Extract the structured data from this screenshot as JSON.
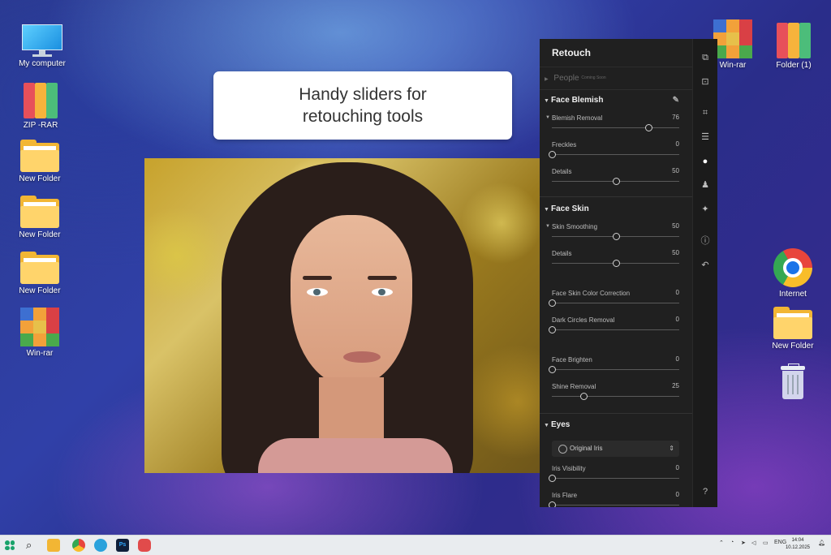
{
  "desktop": {
    "left_icons": [
      {
        "label": "My computer",
        "icon": "monitor-icon"
      },
      {
        "label": "ZIP -RAR",
        "icon": "binders-icon"
      },
      {
        "label": "New Folder",
        "icon": "folder-icon"
      },
      {
        "label": "New Folder",
        "icon": "folder-icon"
      },
      {
        "label": "New Folder",
        "icon": "folder-icon"
      },
      {
        "label": "Win-rar",
        "icon": "winrar-icon"
      }
    ],
    "right_icons": [
      {
        "label": "Win-rar",
        "icon": "winrar-icon"
      },
      {
        "label": "Folder (1)",
        "icon": "binders-icon"
      },
      {
        "label": "Internet",
        "icon": "chrome-icon"
      },
      {
        "label": "New Folder",
        "icon": "folder-icon"
      },
      {
        "label": "",
        "icon": "recycle-bin-icon"
      }
    ]
  },
  "callout": {
    "line1": "Handy sliders for",
    "line2": "retouching tools"
  },
  "retouch_panel": {
    "title": "Retouch",
    "people": {
      "label": "People",
      "badge": "Coming Soon"
    },
    "face_blemish": {
      "title": "Face Blemish",
      "sliders": [
        {
          "label": "Blemish Removal",
          "value": "76",
          "level": 76
        },
        {
          "label": "Freckles",
          "value": "0",
          "level": 0
        },
        {
          "label": "Details",
          "value": "50",
          "level": 50
        }
      ]
    },
    "face_skin": {
      "title": "Face Skin",
      "sliders": [
        {
          "label": "Skin Smoothing",
          "value": "50",
          "level": 50
        },
        {
          "label": "Details",
          "value": "50",
          "level": 50
        },
        {
          "label": "Face Skin Color Correction",
          "value": "0",
          "level": 0
        },
        {
          "label": "Dark Circles Removal",
          "value": "0",
          "level": 0
        },
        {
          "label": "Face Brighten",
          "value": "0",
          "level": 0
        },
        {
          "label": "Shine Removal",
          "value": "25",
          "level": 25
        }
      ]
    },
    "eyes": {
      "title": "Eyes",
      "iris_dropdown": "Original Iris",
      "sliders": [
        {
          "label": "Iris Visibility",
          "value": "0",
          "level": 0
        },
        {
          "label": "Iris Flare",
          "value": "0",
          "level": 0
        }
      ]
    }
  },
  "tool_rail": [
    "layers-icon",
    "select-icon",
    "crop-icon",
    "adjust-icon",
    "person-icon",
    "body-icon",
    "sparkle-icon",
    "info-icon",
    "undo-icon",
    "help-icon"
  ],
  "taskbar": {
    "apps": [
      "windows-start-icon",
      "search-icon",
      "file-explorer-icon",
      "chrome-icon",
      "telegram-icon",
      "photoshop-icon",
      "app-icon"
    ],
    "photoshop_label": "Ps",
    "language": "ENG",
    "time": "14:04",
    "date": "10.12.2025"
  },
  "colors": {
    "panel_bg": "#202020",
    "accent_desktop": "#3040a8",
    "folder_yellow": "#f2b634"
  }
}
